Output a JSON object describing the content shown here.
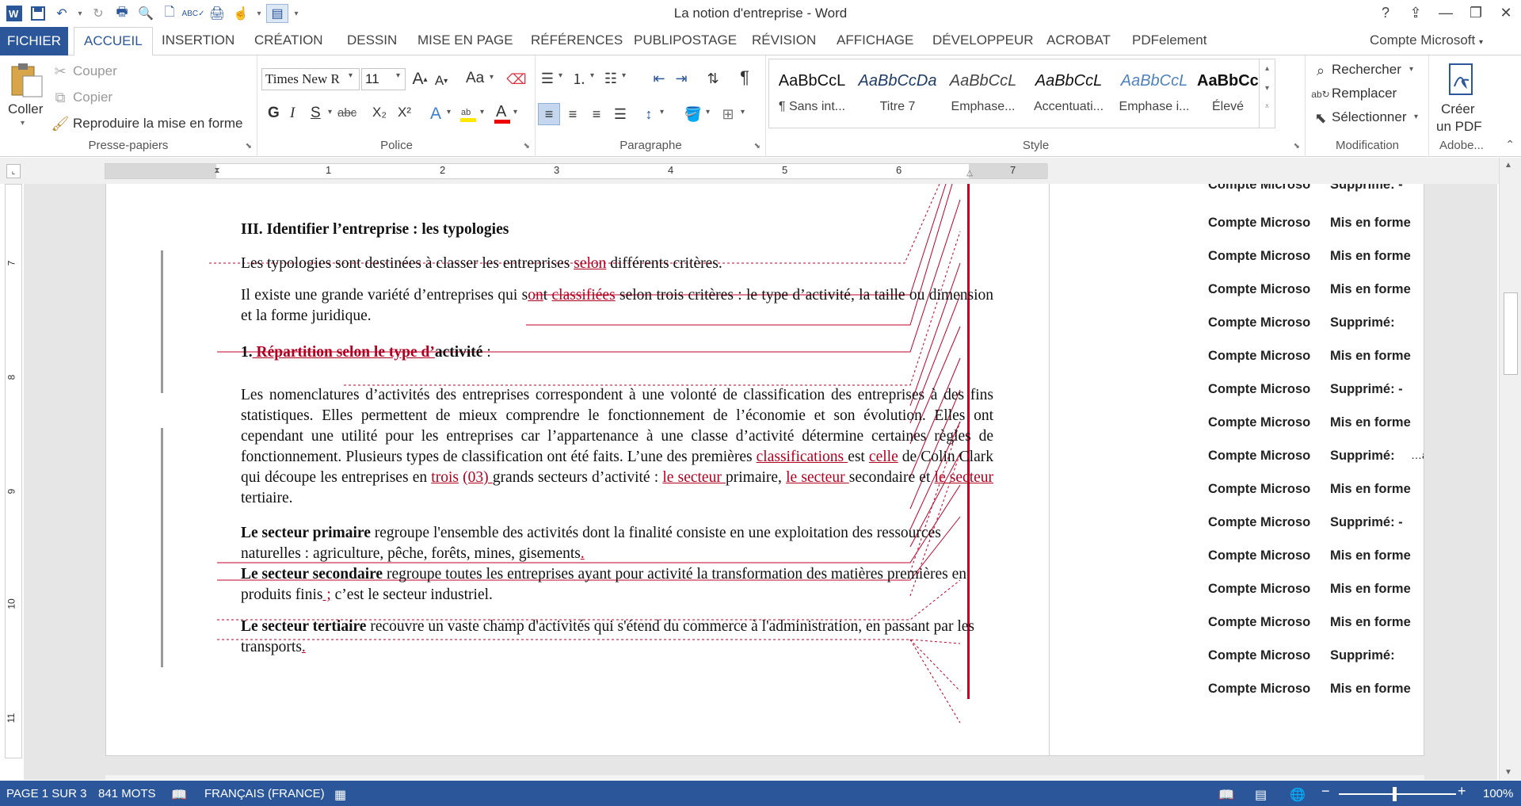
{
  "window": {
    "title": "La notion d'entreprise - Word"
  },
  "tabs": {
    "file": "FICHIER",
    "items": [
      "ACCUEIL",
      "INSERTION",
      "CRÉATION",
      "DESSIN",
      "MISE EN PAGE",
      "RÉFÉRENCES",
      "PUBLIPOSTAGE",
      "RÉVISION",
      "AFFICHAGE",
      "DÉVELOPPEUR",
      "ACROBAT",
      "PDFelement"
    ],
    "account": "Compte Microsoft"
  },
  "ribbon": {
    "clipboard": {
      "paste": "Coller",
      "cut": "Couper",
      "copy": "Copier",
      "format_painter": "Reproduire la mise en forme",
      "label": "Presse-papiers"
    },
    "font": {
      "name": "Times New R",
      "size": "11",
      "label": "Police",
      "bold": "G",
      "italic": "I",
      "underline": "S",
      "strike": "abc",
      "sub": "X₂",
      "sup": "X²",
      "case": "Aa"
    },
    "paragraph": {
      "label": "Paragraphe"
    },
    "styles": {
      "label": "Style",
      "items": [
        {
          "preview": "AaBbCcL",
          "name": "¶ Sans int..."
        },
        {
          "preview": "AaBbCcDa",
          "name": "Titre 7"
        },
        {
          "preview": "AaBbCcL",
          "name": "Emphase..."
        },
        {
          "preview": "AaBbCcL",
          "name": "Accentuati..."
        },
        {
          "preview": "AaBbCcL",
          "name": "Emphase i..."
        },
        {
          "preview": "AaBbCcL",
          "name": "Élevé"
        }
      ]
    },
    "editing": {
      "find": "Rechercher",
      "replace": "Remplacer",
      "select": "Sélectionner",
      "label": "Modification"
    },
    "adobe": {
      "create_line1": "Créer",
      "create_line2": "un PDF",
      "label": "Adobe..."
    }
  },
  "ruler": {
    "h_numbers": [
      "1",
      "2",
      "3",
      "4",
      "5",
      "6",
      "7"
    ],
    "v_numbers": [
      "7",
      "8",
      "9",
      "10",
      "11"
    ]
  },
  "document": {
    "heading": "III. Identifier l’entreprise : les typologies",
    "p1": {
      "a": "Les typologies sont destinées à classer les entreprises ",
      "b": "selon",
      "c": " différents critères."
    },
    "p2": {
      "a": "Il existe une grande variété d’entreprises qui s",
      "b": "on",
      "c": "t ",
      "d": "classifiées",
      "e": " selon trois critères : le type d’activité, la taille ou dimension et la forme juridique."
    },
    "h1": {
      "num": "1.",
      "a": " Répartition selon le type ",
      "b": "d’",
      "c": "activité",
      "d": " :"
    },
    "p3": {
      "a": "Les nomenclatures d’activités des entreprises correspondent à une volonté de classification des entreprises à des fins statistiques. Elles permettent de mieux comprendre le fonctionnement de l’économie et son évolution. Elles ont cependant une utilité pour les entreprises car l’appartenance à une classe d’activité détermine certaines règles de fonctionnement. Plusieurs types de classification ont été faits. L’une des premières ",
      "b": "classifications ",
      "c": "est ",
      "d": "celle",
      "e": " de Colin Clark qui découpe les entreprises en ",
      "f": "trois",
      "g": " ",
      "h": "(03) ",
      "i": "grands secteurs d’activité",
      "j": " : ",
      "k": "le secteur ",
      "l": "primaire, ",
      "m": "le secteur ",
      "n": "secondaire et ",
      "o": "le secteur",
      "p": " tertiaire."
    },
    "p4": {
      "bold": "Le secteur primaire",
      "a": " regroupe l'ensemble des activités dont la finalité consiste en une exploitation des ressources naturelles : agriculture, pêche, forêts, mines, gisements",
      "b": "."
    },
    "p5": {
      "bold": "Le secteur secondaire",
      "a": " regroupe toutes les entreprises ayant pour activité la transformation des matières premières en produits finis",
      "b": " ;",
      "c": " c’est le secteur industriel."
    },
    "p6": {
      "bold": "Le secteur tertiaire",
      "a": " recouvre un vaste champ d'activités qui s'étend du commerce à l'administration, en passant par les transports",
      "b": "."
    }
  },
  "markup": {
    "author": "Compte Microso",
    "items": [
      {
        "kind": "Supprimé: -",
        "dropdown": false
      },
      {
        "kind": "Mis en forme",
        "dropdown": true
      },
      {
        "kind": "Mis en forme",
        "dropdown": true
      },
      {
        "kind": "Mis en forme",
        "dropdown": true
      },
      {
        "kind": "Supprimé:",
        "dropdown": false
      },
      {
        "kind": "Mis en forme",
        "dropdown": true
      },
      {
        "kind": "Supprimé: -",
        "dropdown": false
      },
      {
        "kind": "Mis en forme",
        "dropdown": true
      },
      {
        "kind": "Supprimé:",
        "extra": "…atières premières",
        "dropdown": true
      },
      {
        "kind": "Mis en forme",
        "dropdown": true
      },
      {
        "kind": "Supprimé: -",
        "dropdown": false
      },
      {
        "kind": "Mis en forme",
        "dropdown": true
      },
      {
        "kind": "Mis en forme",
        "dropdown": true
      },
      {
        "kind": "Mis en forme",
        "dropdown": true
      },
      {
        "kind": "Supprimé:",
        "dropdown": false
      },
      {
        "kind": "Mis en forme",
        "dropdown": true
      }
    ]
  },
  "status": {
    "page": "PAGE 1 SUR 3",
    "words": "841 MOTS",
    "language": "FRANÇAIS (FRANCE)",
    "zoom": "100%"
  },
  "colors": {
    "brand": "#2b579a",
    "revision": "#b00020"
  }
}
